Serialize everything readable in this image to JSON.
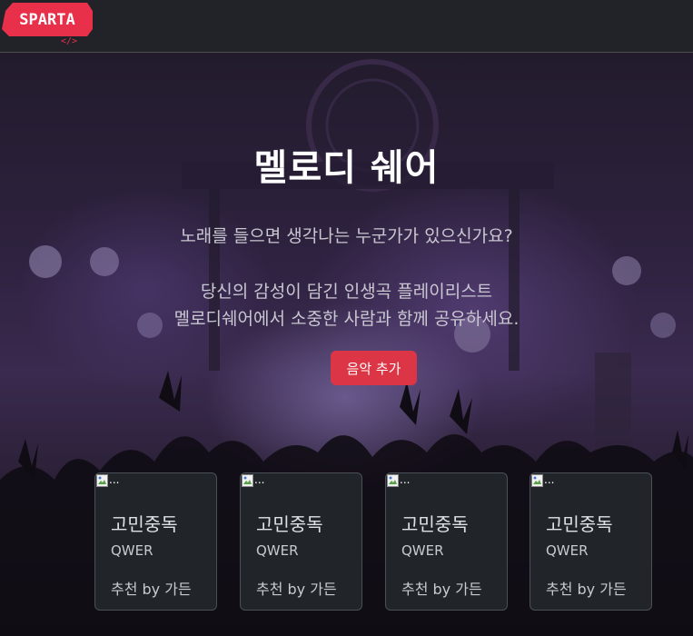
{
  "brand": {
    "logo_text": "SPARTA",
    "logo_sub": "</>"
  },
  "hero": {
    "title": "멜로디 쉐어",
    "subtitle": "노래를 들으면 생각나는 누군가가 있으신가요?",
    "description_line1": "당신의 감성이 담긴 인생곡 플레이리스트",
    "description_line2": "멜로디쉐어에서 소중한 사람과 함께 공유하세요.",
    "add_button_label": "음악 추가"
  },
  "cards": [
    {
      "image_alt": "...",
      "title": "고민중독",
      "artist": "QWER",
      "recommendation": "추천 by 가든"
    },
    {
      "image_alt": "...",
      "title": "고민중독",
      "artist": "QWER",
      "recommendation": "추천 by 가든"
    },
    {
      "image_alt": "...",
      "title": "고민중독",
      "artist": "QWER",
      "recommendation": "추천 by 가든"
    },
    {
      "image_alt": "...",
      "title": "고민중독",
      "artist": "QWER",
      "recommendation": "추천 by 가든"
    }
  ],
  "colors": {
    "accent": "#dc3545",
    "logo": "#e8304a",
    "card_bg": "#212529",
    "navbar_bg": "#212329"
  }
}
